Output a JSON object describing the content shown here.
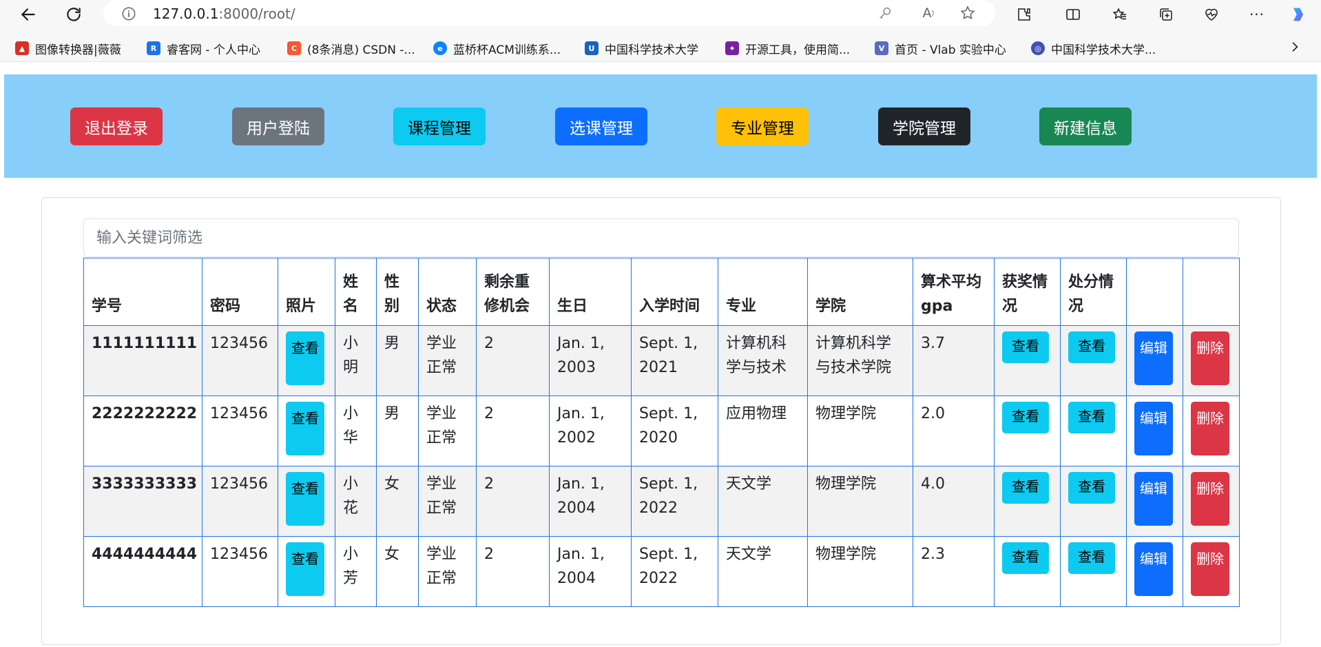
{
  "browser": {
    "url_host": "127.0.0.1",
    "url_rest": ":8000/root/",
    "bookmarks": [
      {
        "label": "图像转换器|薇薇",
        "color": "#d93025",
        "glyph": "▲"
      },
      {
        "label": "睿客网 - 个人中心",
        "color": "#1a73e8",
        "glyph": "R"
      },
      {
        "label": "(8条消息) CSDN -...",
        "color": "#fc5531",
        "glyph": "C"
      },
      {
        "label": "蓝桥杯ACM训练系...",
        "color": "#0a84ff",
        "glyph": "e"
      },
      {
        "label": "中国科学技术大学",
        "color": "#1565c0",
        "glyph": "U"
      },
      {
        "label": "开源工具，使用简...",
        "color": "#7b1fa2",
        "glyph": "✦"
      },
      {
        "label": "首页 - Vlab 实验中心",
        "color": "#5c6bc0",
        "glyph": "V"
      },
      {
        "label": "中国科学技术大学...",
        "color": "#3f51b5",
        "glyph": "◎"
      }
    ]
  },
  "nav": {
    "buttons": [
      {
        "label": "退出登录",
        "bg": "#dc3545",
        "fg": "#ffffff"
      },
      {
        "label": "用户登陆",
        "bg": "#6c757d",
        "fg": "#ffffff"
      },
      {
        "label": "课程管理",
        "bg": "#0dcaf0",
        "fg": "#000000"
      },
      {
        "label": "选课管理",
        "bg": "#0d6efd",
        "fg": "#ffffff"
      },
      {
        "label": "专业管理",
        "bg": "#ffc107",
        "fg": "#000000"
      },
      {
        "label": "学院管理",
        "bg": "#212529",
        "fg": "#ffffff"
      },
      {
        "label": "新建信息",
        "bg": "#198754",
        "fg": "#ffffff"
      }
    ]
  },
  "filter": {
    "placeholder": "输入关键词筛选"
  },
  "table": {
    "headers": [
      "学号",
      "密码",
      "照片",
      "姓名",
      "性别",
      "状态",
      "剩余重修机会",
      "生日",
      "入学时间",
      "专业",
      "学院",
      "算术平均gpa",
      "获奖情况",
      "处分情况",
      "",
      ""
    ],
    "view_label": "查看",
    "edit_label": "编辑",
    "delete_label": "删除",
    "rows": [
      {
        "id": "1111111111",
        "password": "123456",
        "name": "小明",
        "gender": "男",
        "status": "学业正常",
        "retakes": "2",
        "birthday": "Jan. 1, 2003",
        "enroll": "Sept. 1, 2021",
        "major": "计算机科学与技术",
        "college": "计算机科学与技术学院",
        "gpa": "3.7"
      },
      {
        "id": "2222222222",
        "password": "123456",
        "name": "小华",
        "gender": "男",
        "status": "学业正常",
        "retakes": "2",
        "birthday": "Jan. 1, 2002",
        "enroll": "Sept. 1, 2020",
        "major": "应用物理",
        "college": "物理学院",
        "gpa": "2.0"
      },
      {
        "id": "3333333333",
        "password": "123456",
        "name": "小花",
        "gender": "女",
        "status": "学业正常",
        "retakes": "2",
        "birthday": "Jan. 1, 2004",
        "enroll": "Sept. 1, 2022",
        "major": "天文学",
        "college": "物理学院",
        "gpa": "4.0"
      },
      {
        "id": "4444444444",
        "password": "123456",
        "name": "小芳",
        "gender": "女",
        "status": "学业正常",
        "retakes": "2",
        "birthday": "Jan. 1, 2004",
        "enroll": "Sept. 1, 2022",
        "major": "天文学",
        "college": "物理学院",
        "gpa": "2.3"
      }
    ]
  }
}
